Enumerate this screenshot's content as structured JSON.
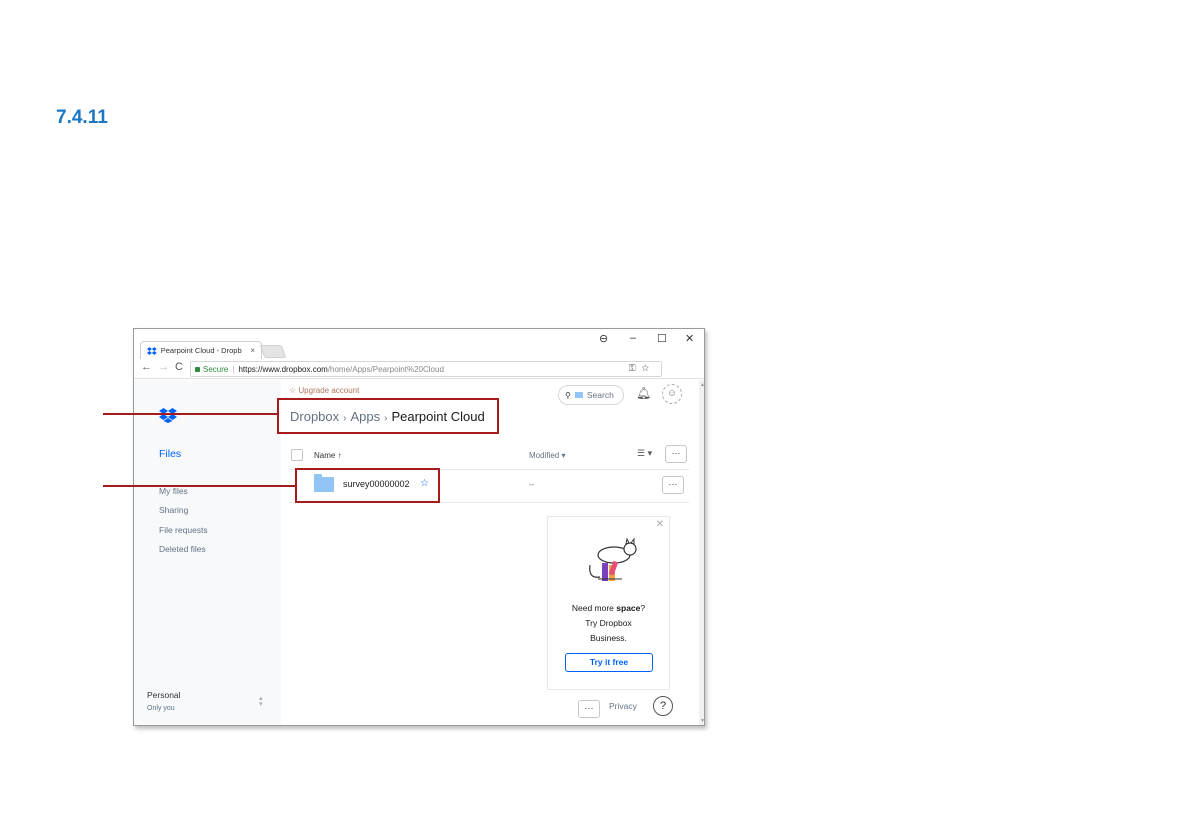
{
  "section_number": "7.4.11",
  "browser": {
    "tab_title": "Pearpoint Cloud - Dropb",
    "tab_close": "×",
    "window_controls": {
      "account": "⊖",
      "minimize": "–",
      "maximize": "☐",
      "close": "✕"
    },
    "nav": {
      "back": "←",
      "forward": "→",
      "reload": "C"
    },
    "secure_label": "Secure",
    "url_host": "https://www.dropbox.com",
    "url_path": "/home/Apps/Pearpoint%20Cloud",
    "menu": "⋮"
  },
  "sidebar": {
    "files_label": "Files",
    "items": [
      "My files",
      "Sharing",
      "File requests",
      "Deleted files"
    ],
    "account_name": "Personal",
    "account_sub": "Only you"
  },
  "main": {
    "upgrade_label": "Upgrade account",
    "breadcrumb": [
      "Dropbox",
      "Apps",
      "Pearpoint Cloud"
    ],
    "search_label": "Search",
    "columns": {
      "name": "Name ↑",
      "modified": "Modified ▾"
    },
    "more_label": "···",
    "files": [
      {
        "name": "survey00000002",
        "modified": "--"
      }
    ],
    "promo": {
      "line1_prefix": "Need more ",
      "line1_bold": "space",
      "line1_suffix": "?",
      "line2": "Try Dropbox",
      "line3": "Business.",
      "button": "Try it free",
      "close": "✕"
    },
    "privacy_label": "Privacy",
    "help_label": "?"
  },
  "colors": {
    "callout": "#a61c1c",
    "heading": "#1a77c4",
    "dropbox_blue": "#0061fe"
  }
}
